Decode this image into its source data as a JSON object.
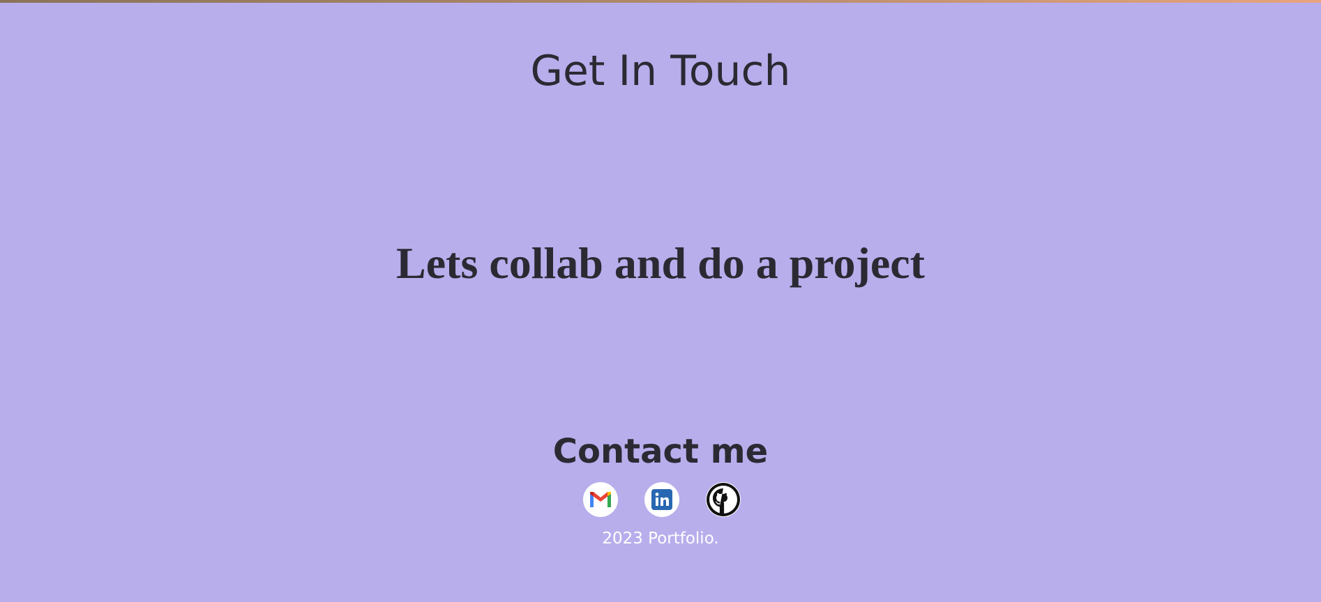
{
  "page": {
    "background_color": "#b8aeec",
    "text_color": "#2b2a33",
    "top_bar_gradient": [
      "#8a7458",
      "#b08a6a",
      "#e8a47e"
    ]
  },
  "header": {
    "title": "Get In Touch"
  },
  "main": {
    "tagline": "Lets collab and do a project"
  },
  "contact": {
    "heading": "Contact me",
    "links": [
      {
        "name": "gmail",
        "icon": "gmail-icon"
      },
      {
        "name": "linkedin",
        "icon": "linkedin-icon",
        "color": "#2867b2"
      },
      {
        "name": "github",
        "icon": "github-icon",
        "color": "#111111"
      }
    ]
  },
  "footer": {
    "copyright": "2023 Portfolio."
  }
}
